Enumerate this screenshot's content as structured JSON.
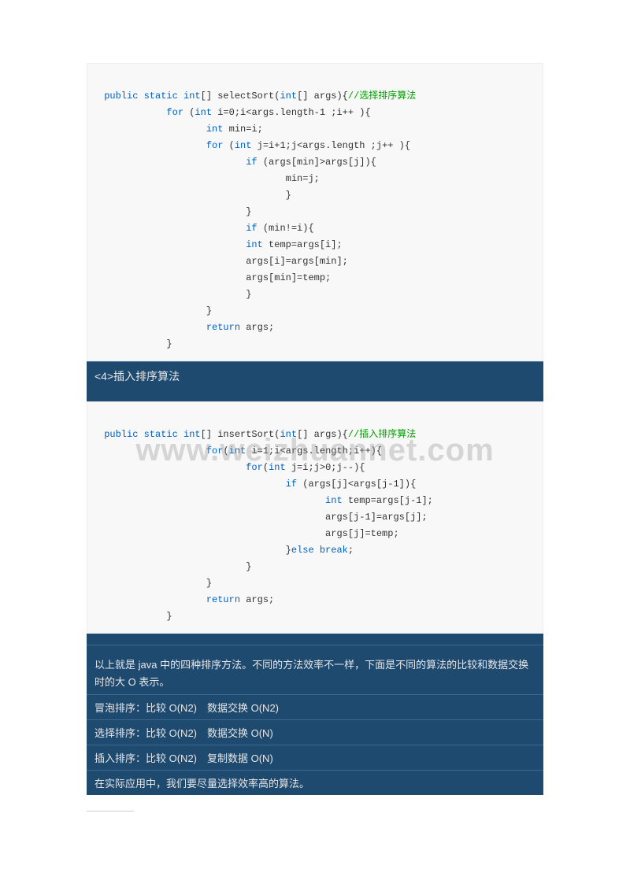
{
  "watermark": "www.weizhuannet.com",
  "code1": {
    "sig_pre": " public static int",
    "sig_mid1": "[] selectSort(",
    "sig_int": "int",
    "sig_mid2": "[] args){",
    "sig_comment": "//选择排序算法",
    "l2a": "            for ",
    "l2b": "(",
    "l2c": "int",
    "l2d": " i=0;i<args.length-1 ;i++ ){",
    "l3a": "                   int",
    "l3b": " min=i;",
    "l4a": "                   for ",
    "l4b": "(",
    "l4c": "int",
    "l4d": " j=i+1;j<args.length ;j++ ){",
    "l5a": "                          if ",
    "l5b": "(args[min]>args[j]){",
    "l6": "                                 min=j;",
    "l7": "                                 }",
    "l8": "                          }",
    "l9a": "                          if ",
    "l9b": "(min!=i){",
    "l10a": "                          int",
    "l10b": " temp=args[i];",
    "l11": "                          args[i]=args[min];",
    "l12": "                          args[min]=temp;",
    "l13": "                          }",
    "l14": "                   }",
    "l15a": "                   return",
    "l15b": " args;",
    "l16": "            }"
  },
  "header2": "<4>插入排序算法",
  "code2": {
    "sig_pre": " public static int",
    "sig_mid1": "[] insertSort(",
    "sig_int": "int",
    "sig_mid2": "[] args){",
    "sig_comment": "//插入排序算法",
    "l2a": "                   for",
    "l2b": "(",
    "l2c": "int",
    "l2d": " i=1;i<args.length;i++){",
    "l3a": "                          for",
    "l3b": "(",
    "l3c": "int",
    "l3d": " j=i;j>0;j--){",
    "l4a": "                                 if ",
    "l4b": "(args[j]<args[j-1]){",
    "l5a": "                                        int",
    "l5b": " temp=args[j-1];",
    "l6": "                                        args[j-1]=args[j];",
    "l7": "                                        args[j]=temp;",
    "l8a": "                                 }",
    "l8b": "else break",
    "l8c": ";",
    "l9": "                          }",
    "l10": "                   }",
    "l11a": "                   return",
    "l11b": " args;",
    "l12": "            }"
  },
  "summary": {
    "intro": "以上就是 java 中的四种排序方法。不同的方法效率不一样，下面是不同的算法的比较和数据交换时的大 O 表示。",
    "row1": "冒泡排序：比较 O(N2)　数据交换 O(N2)",
    "row2": "选择排序：比较 O(N2)　数据交换 O(N)",
    "row3": "插入排序：比较 O(N2)　复制数据 O(N)",
    "outro": "在实际应用中，我们要尽量选择效率高的算法。"
  }
}
